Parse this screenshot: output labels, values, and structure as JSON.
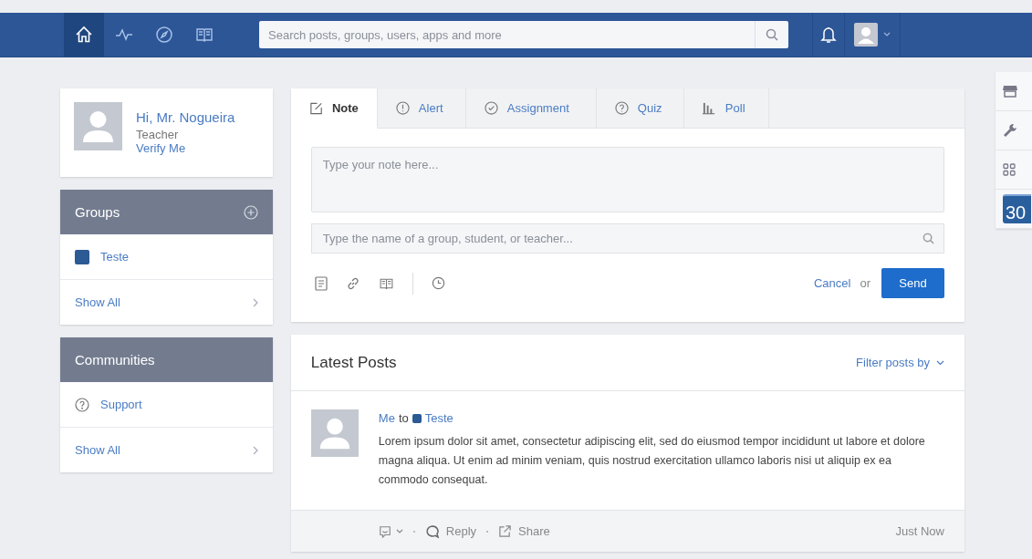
{
  "nav": {
    "items": [
      {
        "kind": "home",
        "selected": true
      },
      {
        "kind": "activity",
        "selected": false
      },
      {
        "kind": "discover",
        "selected": false
      },
      {
        "kind": "library",
        "selected": false
      }
    ],
    "search": {
      "placeholder": "Search posts, groups, users, apps and more"
    }
  },
  "profile": {
    "greeting": "Hi, Mr. Nogueira",
    "role": "Teacher",
    "link": "Verify Me"
  },
  "groups": {
    "title": "Groups",
    "items": [
      {
        "name": "Teste",
        "color": "#2b5a94"
      }
    ],
    "show_all": "Show All"
  },
  "communities": {
    "title": "Communities",
    "items": [
      {
        "name": "Support"
      }
    ],
    "show_all": "Show All"
  },
  "composer": {
    "tabs": [
      {
        "label": "Note",
        "kind": "note",
        "selected": true
      },
      {
        "label": "Alert",
        "kind": "alert",
        "selected": false
      },
      {
        "label": "Assignment",
        "kind": "assignment",
        "selected": false
      },
      {
        "label": "Quiz",
        "kind": "quiz",
        "selected": false
      },
      {
        "label": "Poll",
        "kind": "poll",
        "selected": false
      }
    ],
    "note_placeholder": "Type your note here...",
    "recipient_placeholder": "Type the name of a group, student, or teacher...",
    "cancel": "Cancel",
    "or": "or",
    "send": "Send"
  },
  "feed": {
    "title": "Latest Posts",
    "filter": "Filter posts by",
    "posts": [
      {
        "author": "Me",
        "to": "to",
        "group": "Teste",
        "color": "#2b5a94",
        "body": "Lorem ipsum dolor sit amet, consectetur adipiscing elit, sed do eiusmod tempor incididunt ut labore et dolore magna aliqua. Ut enim ad minim veniam, quis nostrud exercitation ullamco laboris nisi ut aliquip ex ea commodo consequat.",
        "reply": "Reply",
        "share": "Share",
        "time": "Just Now"
      }
    ]
  },
  "rail": {
    "calendar_day": "30"
  }
}
